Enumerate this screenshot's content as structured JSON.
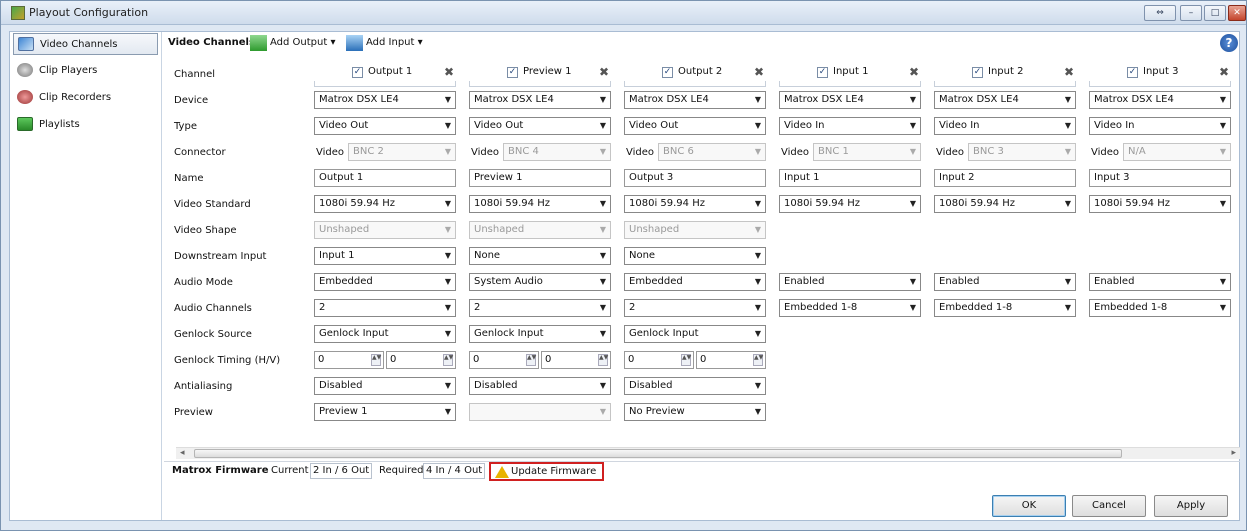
{
  "window": {
    "title": "Playout Configuration"
  },
  "sidebar": {
    "items": [
      {
        "label": "Video Channels",
        "icon": "video-channels-icon"
      },
      {
        "label": "Clip Players",
        "icon": "clip-players-icon"
      },
      {
        "label": "Clip Recorders",
        "icon": "clip-recorders-icon"
      },
      {
        "label": "Playlists",
        "icon": "playlists-icon"
      }
    ]
  },
  "toolbar": {
    "title": "Video Channels",
    "add_output": "Add Output",
    "add_input": "Add Input",
    "help": "?"
  },
  "row_labels": [
    "Channel",
    "Device",
    "Type",
    "Connector",
    "Name",
    "Video Standard",
    "Video Shape",
    "Downstream Input",
    "Audio Mode",
    "Audio Channels",
    "Genlock Source",
    "Genlock Timing (H/V)",
    "Antialiasing",
    "Preview"
  ],
  "channels": [
    {
      "name": "Output 1",
      "checked": true,
      "device": "Matrox DSX LE4",
      "type": "Video Out",
      "connector_label": "Video",
      "connector": "BNC 2",
      "name_value": "Output 1",
      "standard": "1080i 59.94 Hz",
      "shape": "Unshaped",
      "downstream": "Input 1",
      "audio_mode": "Embedded",
      "audio_channels": "2",
      "genlock": "Genlock Input",
      "timing_h": "0",
      "timing_v": "0",
      "antialiasing": "Disabled",
      "preview": "Preview 1"
    },
    {
      "name": "Preview 1",
      "checked": true,
      "device": "Matrox DSX LE4",
      "type": "Video Out",
      "connector_label": "Video",
      "connector": "BNC 4",
      "name_value": "Preview 1",
      "standard": "1080i 59.94 Hz",
      "shape": "Unshaped",
      "downstream": "None",
      "audio_mode": "System Audio",
      "audio_channels": "2",
      "genlock": "Genlock Input",
      "timing_h": "0",
      "timing_v": "0",
      "antialiasing": "Disabled",
      "preview": ""
    },
    {
      "name": "Output 2",
      "checked": true,
      "device": "Matrox DSX LE4",
      "type": "Video Out",
      "connector_label": "Video",
      "connector": "BNC 6",
      "name_value": "Output 3",
      "standard": "1080i 59.94 Hz",
      "shape": "Unshaped",
      "downstream": "None",
      "audio_mode": "Embedded",
      "audio_channels": "2",
      "genlock": "Genlock Input",
      "timing_h": "0",
      "timing_v": "0",
      "antialiasing": "Disabled",
      "preview": "No Preview"
    },
    {
      "name": "Input 1",
      "checked": true,
      "device": "Matrox DSX LE4",
      "type": "Video In",
      "connector_label": "Video",
      "connector": "BNC 1",
      "name_value": "Input 1",
      "standard": "1080i 59.94 Hz",
      "audio_mode": "Enabled",
      "audio_channels": "Embedded 1-8"
    },
    {
      "name": "Input 2",
      "checked": true,
      "device": "Matrox DSX LE4",
      "type": "Video In",
      "connector_label": "Video",
      "connector": "BNC 3",
      "name_value": "Input 2",
      "standard": "1080i 59.94 Hz",
      "audio_mode": "Enabled",
      "audio_channels": "Embedded 1-8"
    },
    {
      "name": "Input 3",
      "checked": true,
      "device": "Matrox DSX LE4",
      "type": "Video In",
      "connector_label": "Video",
      "connector": "N/A",
      "name_value": "Input 3",
      "standard": "1080i 59.94 Hz",
      "audio_mode": "Enabled",
      "audio_channels": "Embedded 1-8"
    }
  ],
  "firmware": {
    "title": "Matrox Firmware",
    "current_label": "Current",
    "current_value": "2 In / 6 Out",
    "required_label": "Required",
    "required_value": "4 In / 4 Out",
    "update_label": "Update Firmware"
  },
  "footer": {
    "ok": "OK",
    "cancel": "Cancel",
    "apply": "Apply"
  }
}
